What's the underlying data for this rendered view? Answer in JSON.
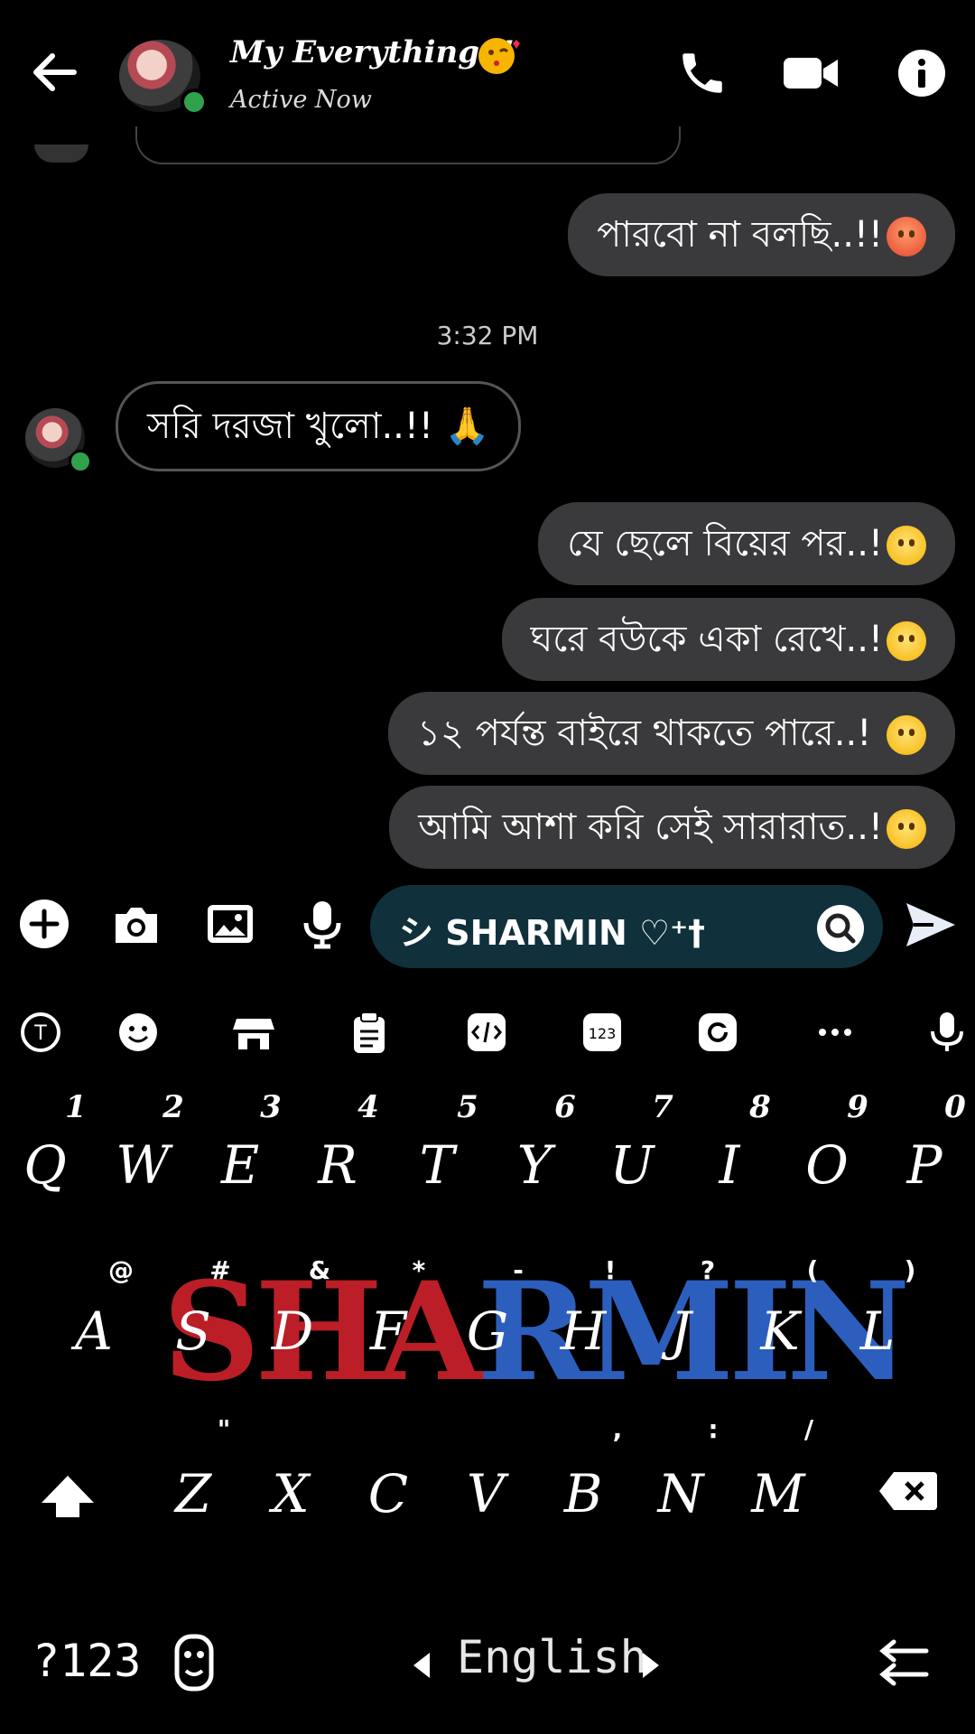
{
  "header": {
    "title": "My Everything..!",
    "status": "Active Now"
  },
  "messages": {
    "out_1": "পারবো না বলছি..!!",
    "timestamp": "3:32 PM",
    "in_1": "সরি দরজা খুলো..!!",
    "out_2": "যে ছেলে বিয়ের পর..!",
    "out_3": "ঘরে বউকে একা রেখে..!",
    "out_4": "১২ পর্যন্ত বাইরে থাকতে পারে..!",
    "out_5": "আমি আশা করি সেই সারারাত..!"
  },
  "composer": {
    "input_value": "シ SHARMIN ♡⁺†"
  },
  "keyboard": {
    "numbers": [
      "1",
      "2",
      "3",
      "4",
      "5",
      "6",
      "7",
      "8",
      "9",
      "0"
    ],
    "row1": [
      "Q",
      "W",
      "E",
      "R",
      "T",
      "Y",
      "U",
      "I",
      "O",
      "P"
    ],
    "row2": [
      "A",
      "S",
      "D",
      "F",
      "G",
      "H",
      "J",
      "K",
      "L"
    ],
    "row2_hints": [
      "@",
      "#",
      "&",
      "*",
      "-",
      "!",
      "?",
      "(",
      ")"
    ],
    "row3": [
      "Z",
      "X",
      "C",
      "V",
      "B",
      "N",
      "M"
    ],
    "row3_hints": [
      "\"",
      ",",
      ":",
      "/"
    ],
    "logo_red": "SHA",
    "logo_blue": "RMIN",
    "symbols_key": "?123",
    "language": "English"
  },
  "colors": {
    "background": "#000000",
    "bubble_out": "#3a3a3c",
    "input_bg": "#10303b",
    "online": "#31a24c"
  }
}
